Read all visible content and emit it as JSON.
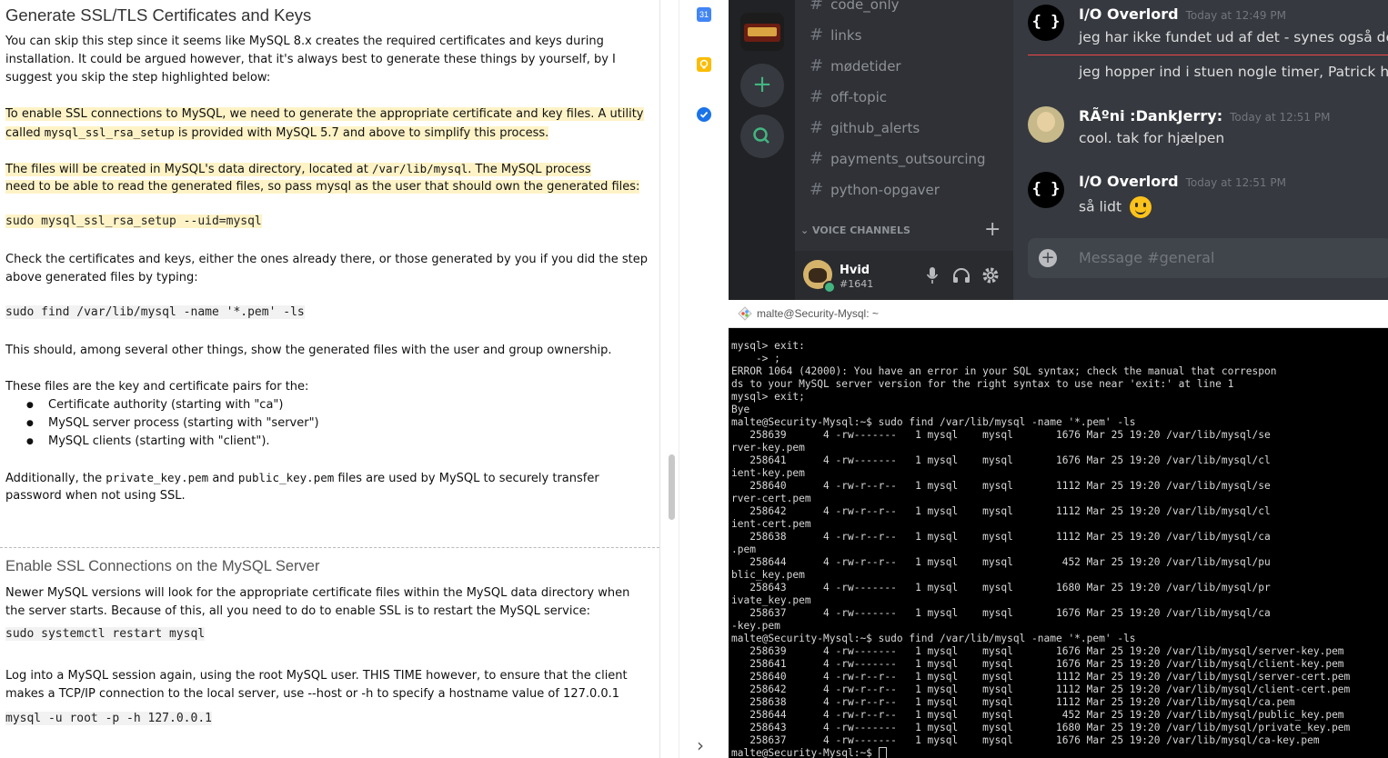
{
  "document": {
    "heading1": "Generate SSL/TLS Certificates and Keys",
    "p1_line1": "You can skip this step since it seems like MySQL 8.x creates the required certificates and keys during",
    "p1_line2": "installation. It could be argued however, that it's always best to generate these things by yourself, by I",
    "p1_line3": "suggest you skip the step highlighted below:",
    "hl1_line1": "To enable SSL connections to MySQL, we need to generate the appropriate certificate and key files. A utility",
    "hl1_line2_a": "called ",
    "hl1_line2_code": "mysql_ssl_rsa_setup",
    "hl1_line2_b": " is provided with MySQL 5.7 and above to simplify this process.",
    "hl2_line1_a": "The files will be created in MySQL's data directory, located at ",
    "hl2_line1_code": "/var/lib/mysql",
    "hl2_line1_b": ". The MySQL process",
    "hl2_line2": "need to be able to read the generated files, so pass mysql as the user that should own the generated files:",
    "hl_code": "sudo mysql_ssl_rsa_setup --uid=mysql",
    "p2_line1": "Check the certificates and keys, either the ones already there, or those generated by you if you did the step",
    "p2_line2": "above generated files by typing:",
    "code2": "sudo find /var/lib/mysql -name '*.pem' -ls",
    "p3": "This should, among several other things, show the generated files with the user and group ownership.",
    "p4": "These files are the key and certificate pairs for the:",
    "bullets": [
      "Certificate authority (starting with \"ca\")",
      "MySQL server process (starting with \"server\")",
      "MySQL clients (starting with \"client\")."
    ],
    "p5_a": "Additionally, the ",
    "p5_code1": "private_key.pem",
    "p5_b": " and ",
    "p5_code2": "public_key.pem",
    "p5_c": " files are used by MySQL to securely transfer",
    "p5_line2": "password when not using SSL.",
    "heading2": "Enable SSL Connections on the MySQL Server",
    "p6_line1": "Newer MySQL versions will look for the appropriate certificate files within the MySQL data directory when",
    "p6_line2": "the server starts. Because of this, all you need to do to enable SSL is to restart the MySQL service:",
    "code3": "sudo systemctl restart mysql",
    "p7_line1": "Log into a MySQL session again, using the root MySQL user. THIS TIME however, to ensure that the client",
    "p7_line2": "makes a TCP/IP connection to the local server, use --host or -h to specify a hostname value of 127.0.0.1",
    "code4": "mysql -u root -p -h 127.0.0.1"
  },
  "rail": {
    "calendar_label": "31",
    "chevron": "›"
  },
  "discord": {
    "channels": [
      "code_only",
      "links",
      "mødetider",
      "off-topic",
      "github_alerts",
      "payments_outsourcing",
      "python-opgaver"
    ],
    "voice_header": "VOICE CHANNELS",
    "user": {
      "name": "Hvid",
      "tag": "#1641"
    },
    "messages": [
      {
        "author": "I/O Overlord",
        "time": "Today at 12:49 PM",
        "lines": [
          "jeg har ikke fundet ud af det - synes også det e",
          "jeg hopper ind i stuen nogle timer, Patrick har"
        ]
      },
      {
        "author": "RÃºni :DankJerry:",
        "time": "Today at 12:51 PM",
        "lines": [
          "cool. tak for hjælpen"
        ]
      },
      {
        "author": "I/O Overlord",
        "time": "Today at 12:51 PM",
        "lines": [
          "så lidt"
        ]
      }
    ],
    "avatar_glyph": "{ }",
    "input_placeholder": "Message #general",
    "colors": {
      "bg": "#36393f",
      "sidebar": "#2f3136",
      "guilds": "#202225",
      "accent": "#43b581"
    }
  },
  "terminal": {
    "title": "malte@Security-Mysql: ~",
    "lines": [
      "mysql> exit:",
      "    -> ;",
      "ERROR 1064 (42000): You have an error in your SQL syntax; check the manual that correspon",
      "ds to your MySQL server version for the right syntax to use near 'exit:' at line 1",
      "mysql> exit;",
      "Bye",
      "malte@Security-Mysql:~$ sudo find /var/lib/mysql -name '*.pem' -ls",
      "   258639      4 -rw-------   1 mysql    mysql       1676 Mar 25 19:20 /var/lib/mysql/se",
      "rver-key.pem",
      "   258641      4 -rw-------   1 mysql    mysql       1676 Mar 25 19:20 /var/lib/mysql/cl",
      "ient-key.pem",
      "   258640      4 -rw-r--r--   1 mysql    mysql       1112 Mar 25 19:20 /var/lib/mysql/se",
      "rver-cert.pem",
      "   258642      4 -rw-r--r--   1 mysql    mysql       1112 Mar 25 19:20 /var/lib/mysql/cl",
      "ient-cert.pem",
      "   258638      4 -rw-r--r--   1 mysql    mysql       1112 Mar 25 19:20 /var/lib/mysql/ca",
      ".pem",
      "   258644      4 -rw-r--r--   1 mysql    mysql        452 Mar 25 19:20 /var/lib/mysql/pu",
      "blic_key.pem",
      "   258643      4 -rw-------   1 mysql    mysql       1680 Mar 25 19:20 /var/lib/mysql/pr",
      "ivate_key.pem",
      "   258637      4 -rw-------   1 mysql    mysql       1676 Mar 25 19:20 /var/lib/mysql/ca",
      "-key.pem",
      "malte@Security-Mysql:~$ sudo find /var/lib/mysql -name '*.pem' -ls",
      "   258639      4 -rw-------   1 mysql    mysql       1676 Mar 25 19:20 /var/lib/mysql/server-key.pem",
      "   258641      4 -rw-------   1 mysql    mysql       1676 Mar 25 19:20 /var/lib/mysql/client-key.pem",
      "   258640      4 -rw-r--r--   1 mysql    mysql       1112 Mar 25 19:20 /var/lib/mysql/server-cert.pem",
      "   258642      4 -rw-r--r--   1 mysql    mysql       1112 Mar 25 19:20 /var/lib/mysql/client-cert.pem",
      "   258638      4 -rw-r--r--   1 mysql    mysql       1112 Mar 25 19:20 /var/lib/mysql/ca.pem",
      "   258644      4 -rw-r--r--   1 mysql    mysql        452 Mar 25 19:20 /var/lib/mysql/public_key.pem",
      "   258643      4 -rw-------   1 mysql    mysql       1680 Mar 25 19:20 /var/lib/mysql/private_key.pem",
      "   258637      4 -rw-------   1 mysql    mysql       1676 Mar 25 19:20 /var/lib/mysql/ca-key.pem",
      "malte@Security-Mysql:~$ "
    ]
  }
}
